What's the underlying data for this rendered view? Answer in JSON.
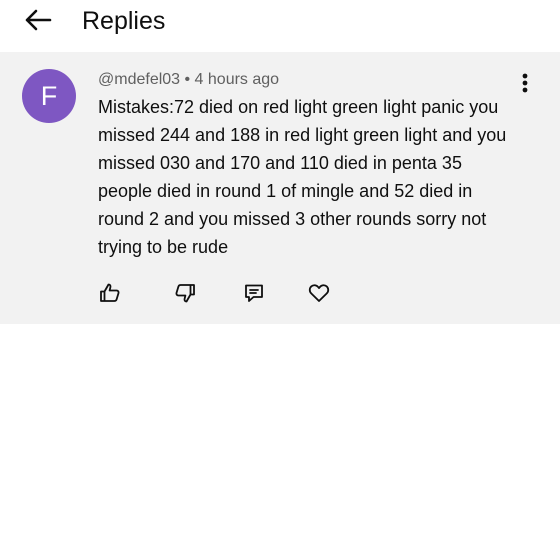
{
  "header": {
    "back_icon": "arrow-left-icon",
    "title": "Replies"
  },
  "reply": {
    "avatar_letter": "F",
    "avatar_color": "#7e57c2",
    "meta": "@mdefel03 • 4 hours ago",
    "more_icon": "more-vertical-icon",
    "text": "Mistakes:72 died on red light green light panic you missed 244 and 188 in red light green light and you missed 030 and 170 and 110 died in penta 35 people died in round 1 of mingle and 52 died in round 2 and you missed 3 other rounds sorry not trying to be rude",
    "actions": [
      {
        "icon": "thumbs-up-icon"
      },
      {
        "icon": "thumbs-down-icon"
      },
      {
        "icon": "reply-comment-icon"
      },
      {
        "icon": "heart-icon"
      }
    ]
  }
}
